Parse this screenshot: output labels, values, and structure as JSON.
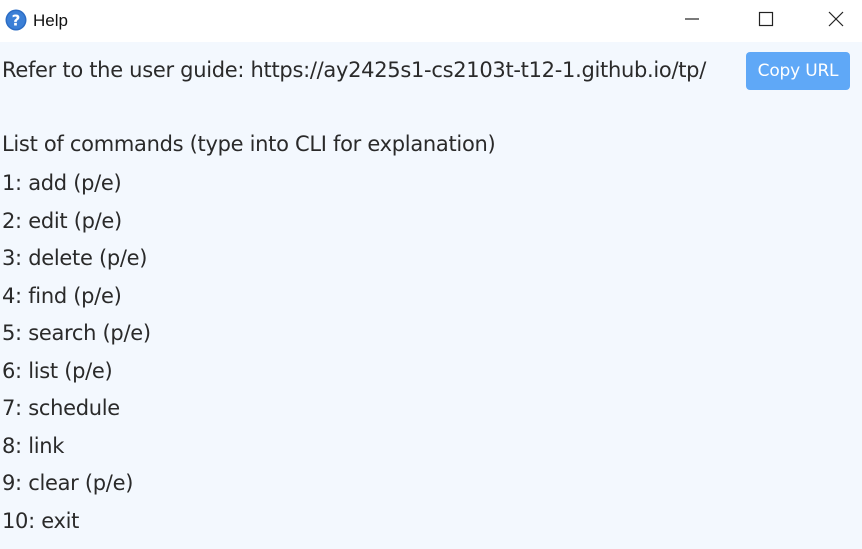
{
  "window": {
    "title": "Help",
    "controls": {
      "minimize": "minimize-icon",
      "maximize": "maximize-icon",
      "close": "close-icon"
    }
  },
  "guide": {
    "text": "Refer to the user guide: https://ay2425s1-cs2103t-t12-1.github.io/tp/",
    "copy_button_label": "Copy URL"
  },
  "commands": {
    "header": "List of commands (type into CLI for explanation)",
    "items": [
      "1: add (p/e)",
      "2: edit (p/e)",
      "3: delete (p/e)",
      "4: find (p/e)",
      "5: search (p/e)",
      "6: list (p/e)",
      "7: schedule",
      "8: link",
      "9: clear (p/e)",
      "10: exit"
    ]
  },
  "colors": {
    "background": "#f3f8fe",
    "button": "#5fa8f7",
    "icon": "#2b6cc4"
  }
}
